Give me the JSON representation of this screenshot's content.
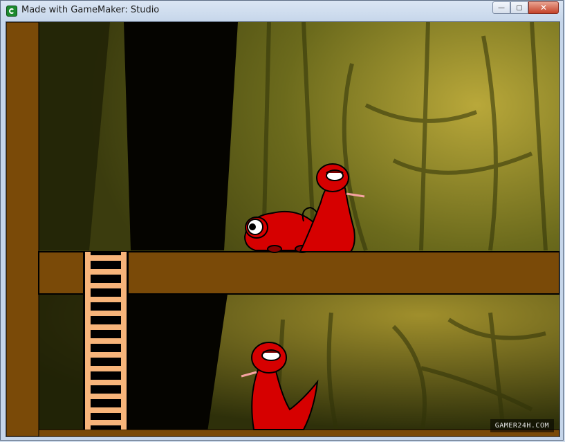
{
  "window": {
    "title": "Made with GameMaker: Studio",
    "controls": {
      "minimize": "—",
      "maximize": "▢",
      "close": "✕"
    }
  },
  "game": {
    "watermark": "GAMER24H.COM",
    "colors": {
      "platform": "#7a4a08",
      "ladder": "#f7b47a",
      "creature": "#d60000",
      "jungle": "#6f6c1a"
    },
    "sprites": [
      "red-chameleon",
      "red-snake-upper",
      "red-snake-lower",
      "wooden-ladder"
    ]
  }
}
